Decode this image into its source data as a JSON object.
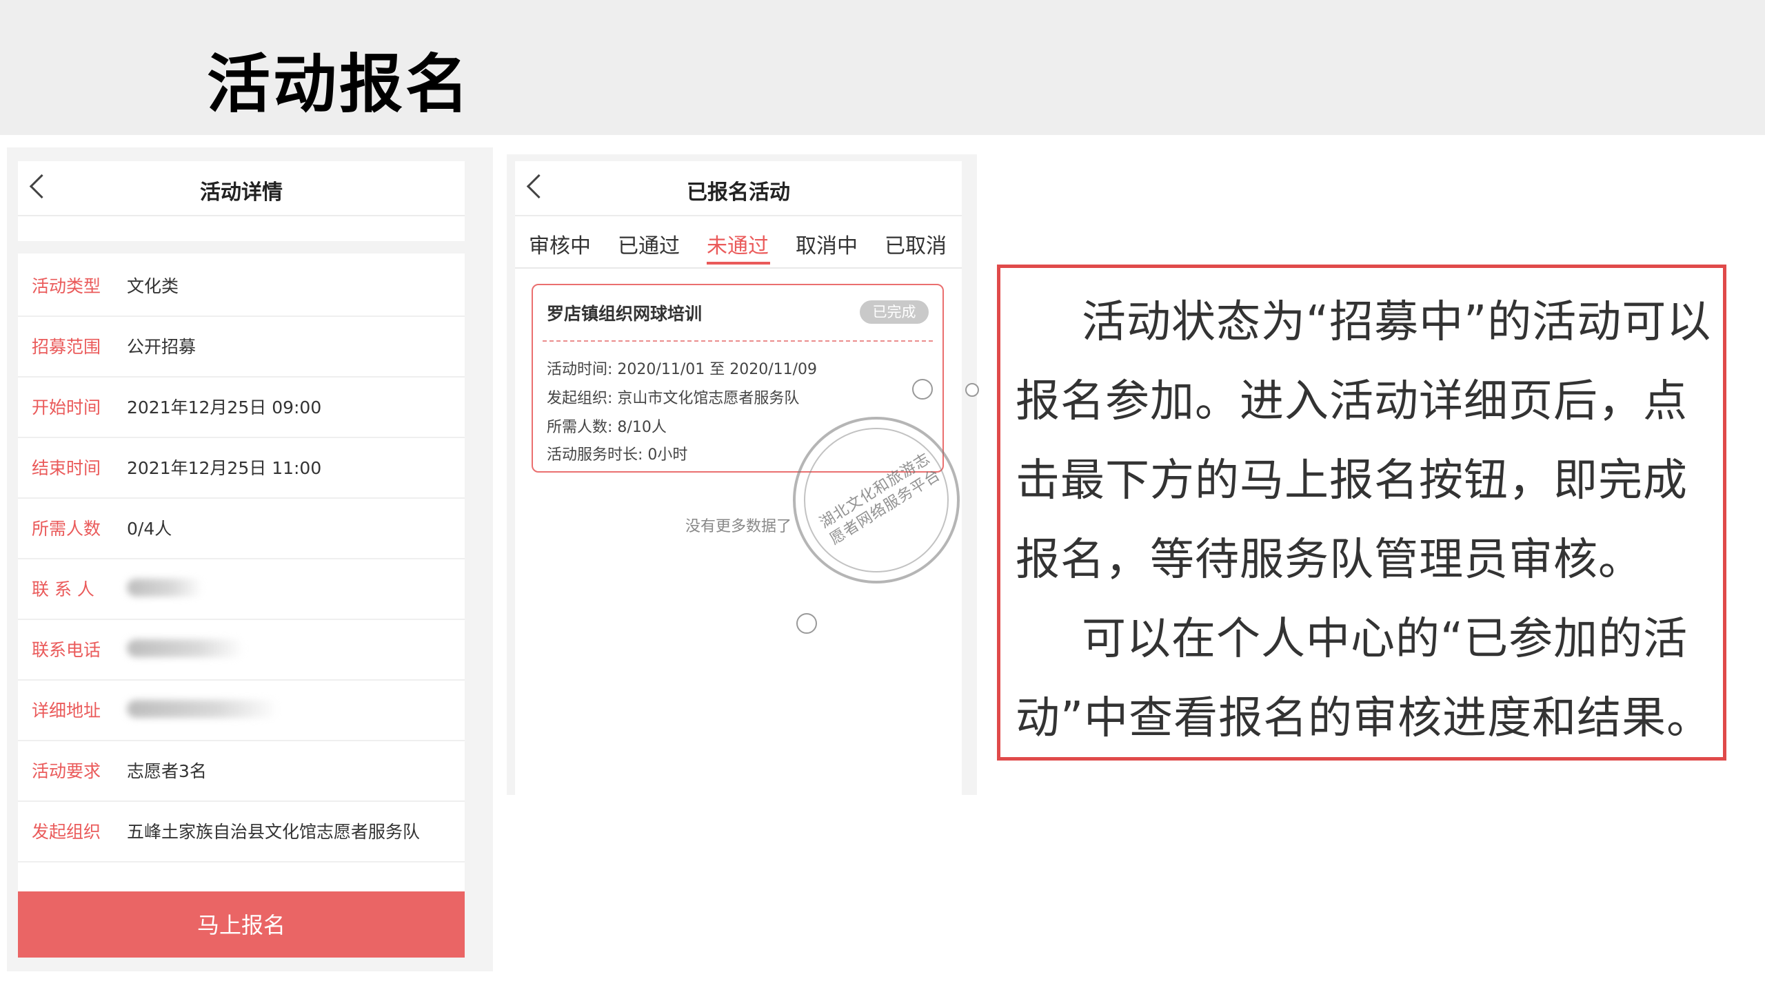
{
  "slide": {
    "title": "活动报名"
  },
  "detail": {
    "header_title": "活动详情",
    "fields": [
      {
        "label": "活动类型",
        "value": "文化类"
      },
      {
        "label": "招募范围",
        "value": "公开招募"
      },
      {
        "label": "开始时间",
        "value": "2021年12月25日 09:00"
      },
      {
        "label": "结束时间",
        "value": "2021年12月25日 11:00"
      },
      {
        "label": "所需人数",
        "value": "0/4人"
      },
      {
        "label": "联 系 人",
        "value": ""
      },
      {
        "label": "联系电话",
        "value": ""
      },
      {
        "label": "详细地址",
        "value": ""
      },
      {
        "label": "活动要求",
        "value": "志愿者3名"
      },
      {
        "label": "发起组织",
        "value": "五峰土家族自治县文化馆志愿者服务队"
      }
    ],
    "signup_button": "马上报名"
  },
  "registered": {
    "header_title": "已报名活动",
    "tabs": [
      "审核中",
      "已通过",
      "未通过",
      "取消中",
      "已取消"
    ],
    "active_tab": "未通过",
    "card": {
      "title": "罗店镇组织网球培训",
      "badge": "已完成",
      "time_label": "活动时间:",
      "time_value": "2020/11/01 至 2020/11/09",
      "org_label": "发起组织:",
      "org_value": "京山市文化馆志愿者服务队",
      "people_label": "所需人数:",
      "people_value": "8/10人",
      "hours_label": "活动服务时长:",
      "hours_value": "0小时"
    },
    "no_more": "没有更多数据了"
  },
  "stamp": {
    "line1": "湖北文化和旅游志",
    "line2": "愿者网络服务平台"
  },
  "description": {
    "para1": "活动状态为“招募中”的活动可以报名参加。进入活动详细页后，点击最下方的马上报名按钮，即完成报名，等待服务队管理员审核。",
    "para2": "可以在个人中心的“已参加的活动”中查看报名的审核进度和结果。"
  },
  "colors": {
    "accent": "#ea5a5a",
    "button": "#ea6565",
    "badge": "#c9c9c9",
    "border": "#e04a4a"
  }
}
